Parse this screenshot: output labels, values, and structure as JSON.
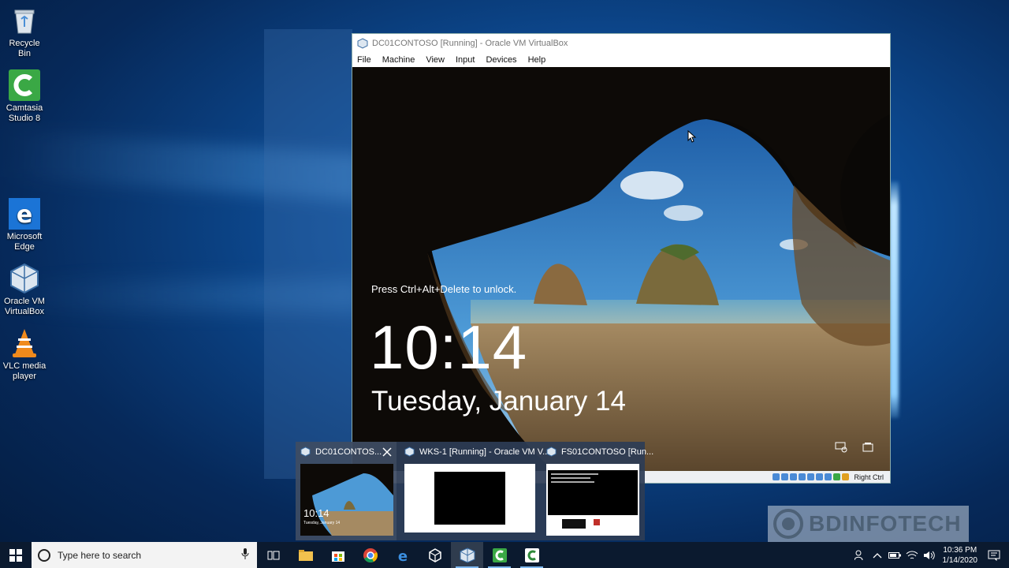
{
  "desktop": {
    "icons": [
      {
        "label": "Recycle Bin",
        "icon": "recycle-bin-icon"
      },
      {
        "label": "Camtasia Studio 8",
        "icon": "camtasia-icon"
      },
      {
        "label": "Microsoft Edge",
        "icon": "edge-icon"
      },
      {
        "label": "Oracle VM VirtualBox",
        "icon": "virtualbox-icon"
      },
      {
        "label": "VLC media player",
        "icon": "vlc-icon"
      }
    ]
  },
  "vbox_window": {
    "title": "DC01CONTOSO [Running] - Oracle VM VirtualBox",
    "menu": [
      "File",
      "Machine",
      "View",
      "Input",
      "Devices",
      "Help"
    ],
    "host_key": "Right Ctrl"
  },
  "lock_screen": {
    "message": "Press Ctrl+Alt+Delete to unlock.",
    "time": "10:14",
    "date": "Tuesday, January 14"
  },
  "previews": [
    {
      "title": "DC01CONTOS...",
      "thumb_time": "10:14",
      "thumb_date": "Tuesday, January 14"
    },
    {
      "title": "WKS-1 [Running] - Oracle VM V..."
    },
    {
      "title": "FS01CONTOSO [Run..."
    }
  ],
  "watermark": "BDINFOTECH",
  "taskbar": {
    "search_placeholder": "Type here to search",
    "time": "10:36 PM",
    "date": "1/14/2020"
  },
  "colors": {
    "taskbar": "#0b1a2f",
    "accent": "#7fb8f0"
  }
}
